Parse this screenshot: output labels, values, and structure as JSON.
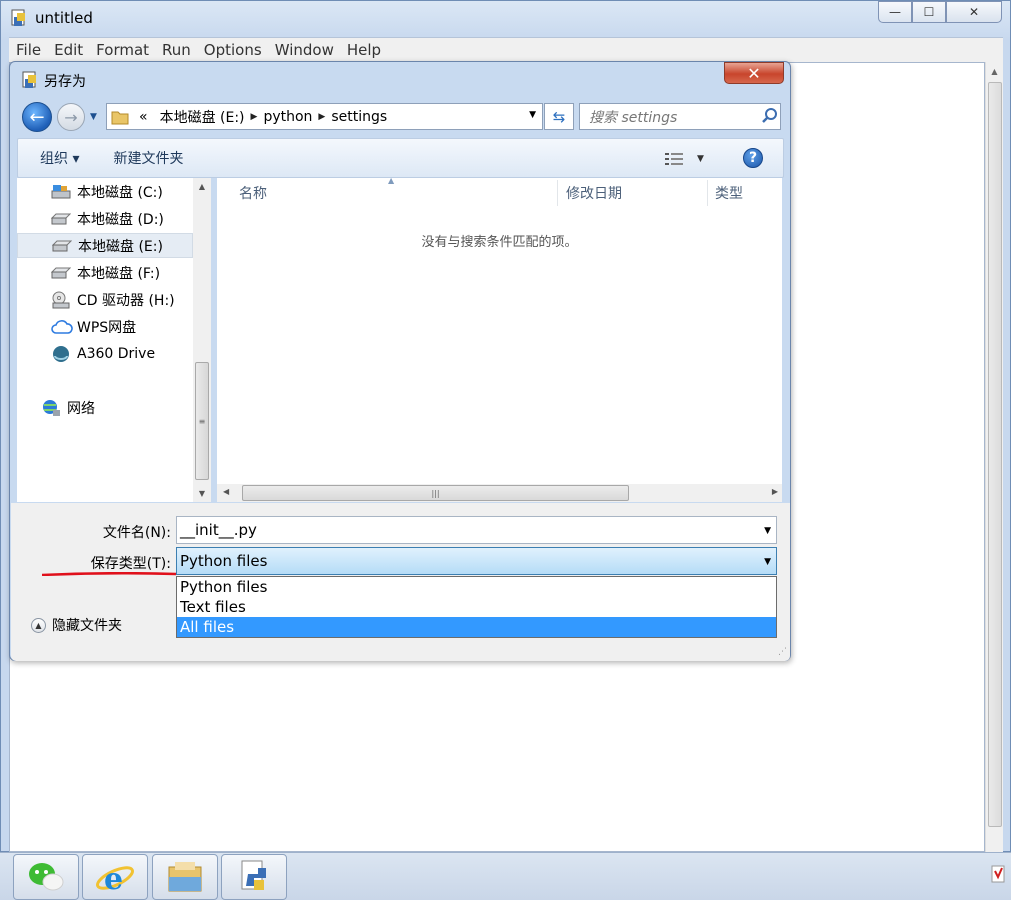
{
  "window": {
    "title": "untitled",
    "controls": {
      "minimize": "—",
      "maximize": "☐",
      "close": "✕"
    }
  },
  "menu": [
    "File",
    "Edit",
    "Format",
    "Run",
    "Options",
    "Window",
    "Help"
  ],
  "dialog": {
    "title": "另存为",
    "close": "✕",
    "address": {
      "overflow": "«",
      "crumbs": [
        "本地磁盘 (E:)",
        "python",
        "settings"
      ]
    },
    "search": {
      "placeholder": "搜索 settings"
    },
    "toolbar": {
      "organize": "组织 ▾",
      "new_folder": "新建文件夹",
      "help": "?"
    },
    "nav_items": [
      {
        "label": "本地磁盘 (C:)",
        "icon": "system-drive-icon"
      },
      {
        "label": "本地磁盘 (D:)",
        "icon": "drive-icon"
      },
      {
        "label": "本地磁盘 (E:)",
        "icon": "drive-icon",
        "selected": true
      },
      {
        "label": "本地磁盘 (F:)",
        "icon": "drive-icon"
      },
      {
        "label": "CD 驱动器 (H:)",
        "icon": "cd-drive-icon"
      },
      {
        "label": "WPS网盘",
        "icon": "cloud-icon"
      },
      {
        "label": "A360 Drive",
        "icon": "a360-icon"
      },
      {
        "label": "网络",
        "icon": "network-icon"
      }
    ],
    "columns": [
      "名称",
      "修改日期",
      "类型"
    ],
    "empty_message": "没有与搜索条件匹配的项。",
    "form": {
      "filename_label": "文件名(N):",
      "filename_value": "__init__.py",
      "filetype_label": "保存类型(T):",
      "filetype_value": "Python files",
      "filetype_options": [
        "Python files",
        "Text files",
        "All files"
      ],
      "highlighted_option": "All files",
      "hide_folders": "隐藏文件夹"
    }
  },
  "taskbar": [
    "wechat-icon",
    "internet-explorer-icon",
    "file-explorer-icon",
    "python-idle-icon"
  ],
  "colors": {
    "accent": "#3399ff",
    "annotation": "#e0101b"
  }
}
